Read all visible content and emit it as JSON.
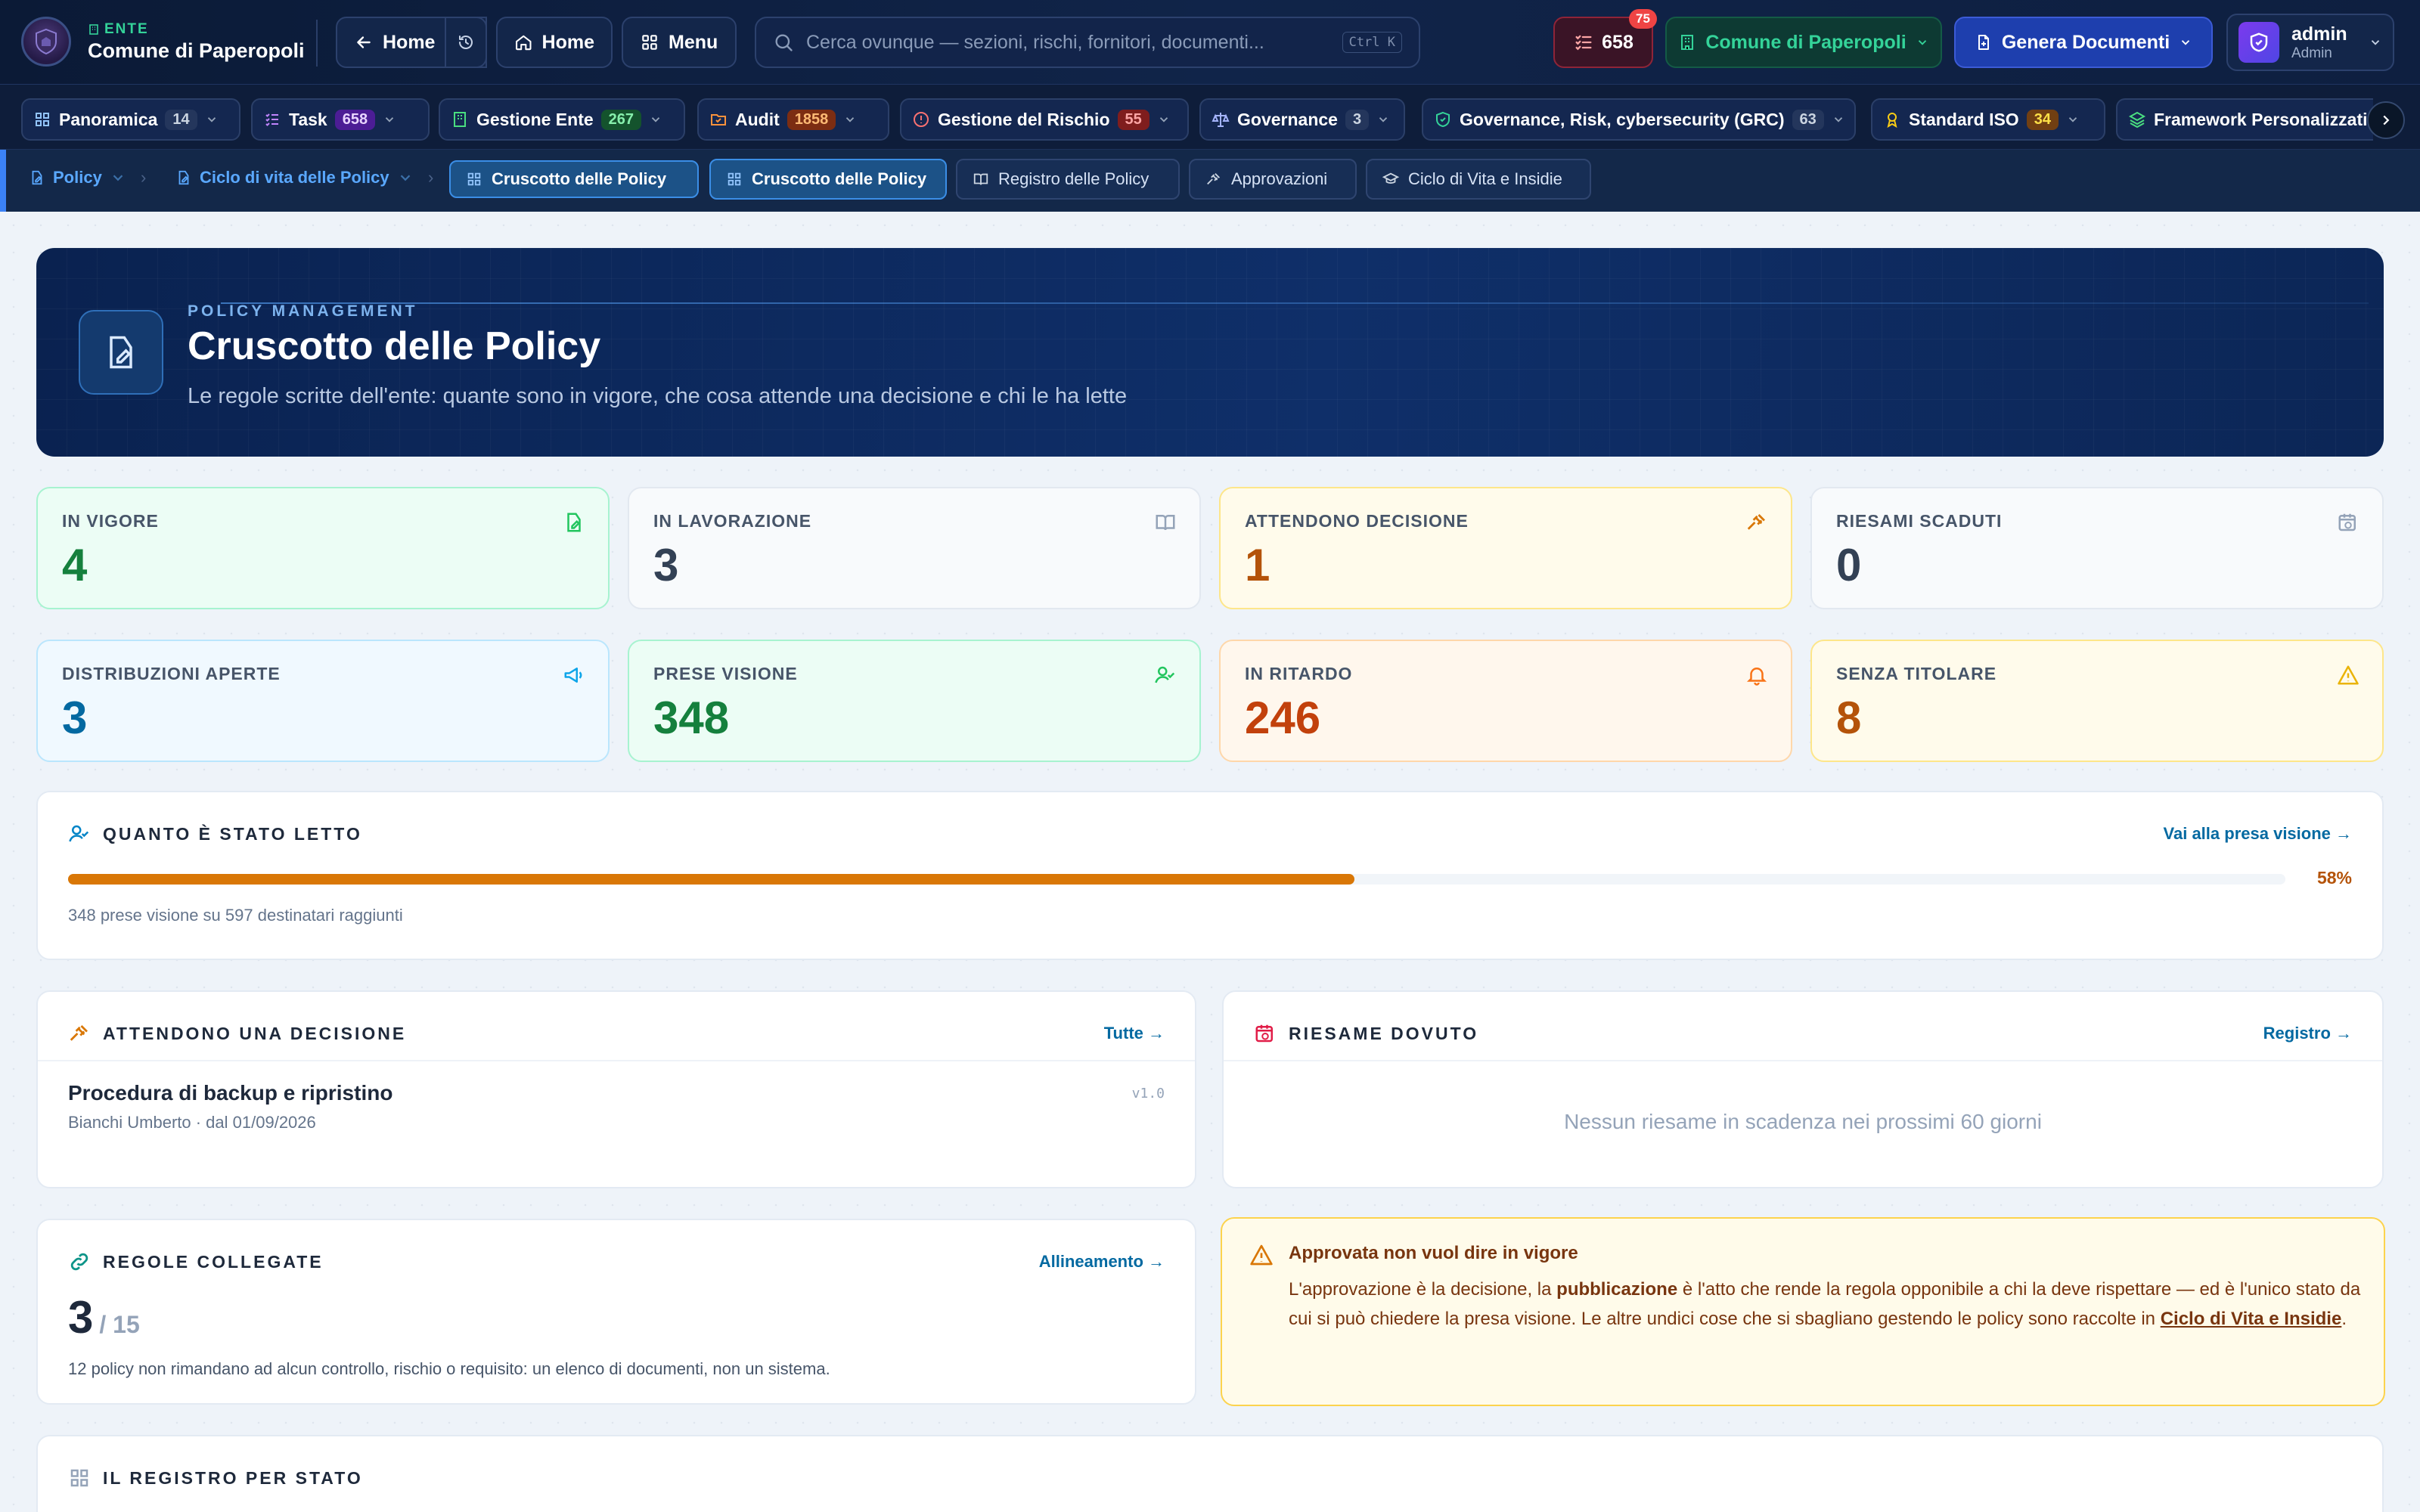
{
  "topbar": {
    "ente_label": "ENTE",
    "ente_name": "Comune di Paperopoli",
    "back_home": "Home",
    "home": "Home",
    "menu": "Menu",
    "search_placeholder": "Cerca ovunque — sezioni, rischi, fornitori, documenti...",
    "search_shortcut": "Ctrl K",
    "tasks_count": "658",
    "notifications_badge": "75",
    "org_selector": "Comune di Paperopoli",
    "generate_button": "Genera Documenti",
    "user_name": "admin",
    "user_role": "Admin"
  },
  "modules": [
    {
      "label": "Panoramica",
      "count": "14",
      "icon": "grid-icon",
      "color": "#94a3b8"
    },
    {
      "label": "Task",
      "count": "658",
      "icon": "checklist-icon",
      "color": "#a855f7"
    },
    {
      "label": "Gestione Ente",
      "count": "267",
      "icon": "building-icon",
      "color": "#22c55e"
    },
    {
      "label": "Audit",
      "count": "1858",
      "icon": "folder-check-icon",
      "color": "#f97316"
    },
    {
      "label": "Gestione del Rischio",
      "count": "55",
      "icon": "alert-circle-icon",
      "color": "#ef4444"
    },
    {
      "label": "Governance",
      "count": "3",
      "icon": "scale-icon",
      "color": "#94a3b8"
    },
    {
      "label": "Governance, Risk, cybersecurity (GRC)",
      "count": "63",
      "icon": "shield-check-icon",
      "color": "#94a3b8"
    },
    {
      "label": "Standard ISO",
      "count": "34",
      "icon": "award-icon",
      "color": "#eab308"
    },
    {
      "label": "Framework Personalizzati",
      "count": "",
      "icon": "layers-icon",
      "color": "#22c55e"
    }
  ],
  "breadcrumb": {
    "items": [
      "Policy",
      "Ciclo di vita delle Policy",
      "Cruscotto delle Policy"
    ],
    "tabs": [
      "Cruscotto delle Policy",
      "Registro delle Policy",
      "Approvazioni",
      "Ciclo di Vita e Insidie"
    ]
  },
  "hero": {
    "eyebrow": "POLICY MANAGEMENT",
    "title": "Cruscotto delle Policy",
    "subtitle": "Le regole scritte dell'ente: quante sono in vigore, che cosa attende una decisione e chi le ha lette"
  },
  "kpis": [
    {
      "label": "IN VIGORE",
      "value": "4",
      "icon": "file-edit-icon",
      "color": "#15803d",
      "bg": "#ecfdf5",
      "border": "#a7f3d0"
    },
    {
      "label": "IN LAVORAZIONE",
      "value": "3",
      "icon": "book-open-icon",
      "color": "#334155",
      "bg": "#f8fafc",
      "border": "#e2e8f0"
    },
    {
      "label": "ATTENDONO DECISIONE",
      "value": "1",
      "icon": "gavel-icon",
      "color": "#b45309",
      "bg": "#fffbeb",
      "border": "#fde68a"
    },
    {
      "label": "RIESAMI SCADUTI",
      "value": "0",
      "icon": "calendar-clock-icon",
      "color": "#334155",
      "bg": "#f8fafc",
      "border": "#e2e8f0"
    },
    {
      "label": "DISTRIBUZIONI APERTE",
      "value": "3",
      "icon": "megaphone-icon",
      "color": "#0369a1",
      "bg": "#f0f9ff",
      "border": "#bae6fd"
    },
    {
      "label": "PRESE VISIONE",
      "value": "348",
      "icon": "user-check-icon",
      "color": "#15803d",
      "bg": "#ecfdf5",
      "border": "#a7f3d0"
    },
    {
      "label": "IN RITARDO",
      "value": "246",
      "icon": "bell-icon",
      "color": "#c2410c",
      "bg": "#fff7ed",
      "border": "#fed7aa"
    },
    {
      "label": "SENZA TITOLARE",
      "value": "8",
      "icon": "warning-icon",
      "color": "#b45309",
      "bg": "#fffbeb",
      "border": "#fde68a"
    }
  ],
  "read_card": {
    "title": "QUANTO È STATO LETTO",
    "link": "Vai alla presa visione →",
    "progress_pct": 58,
    "pct_label": "58%",
    "caption": "348 prese visione su 597 destinatari raggiunti"
  },
  "decision_card": {
    "title": "ATTENDONO UNA DECISIONE",
    "link": "Tutte →",
    "item_title": "Procedura di backup e ripristino",
    "item_meta": "Bianchi Umberto · dal 01/09/2026",
    "item_version": "v1.0"
  },
  "review_card": {
    "title": "RIESAME DOVUTO",
    "link": "Registro →",
    "empty": "Nessun riesame in scadenza nei prossimi 60 giorni"
  },
  "rules_card": {
    "title": "REGOLE COLLEGATE",
    "link": "Allineamento →",
    "value": "3",
    "total": "/ 15",
    "caption": "12 policy non rimandano ad alcun controllo, rischio o requisito: un elenco di documenti, non un sistema."
  },
  "warning": {
    "title": "Approvata non vuol dire in vigore",
    "text1": "L'approvazione è la decisione, la ",
    "strong": "pubblicazione",
    "text2": " è l'atto che rende la regola opponibile a chi la deve rispettare — ed è l'unico stato da cui si può chiedere la presa visione. Le altre undici cose che si sbagliano gestendo le policy sono raccolte in ",
    "link": "Ciclo di Vita e Insidie",
    "text3": "."
  },
  "registry_card": {
    "title": "IL REGISTRO PER STATO"
  }
}
